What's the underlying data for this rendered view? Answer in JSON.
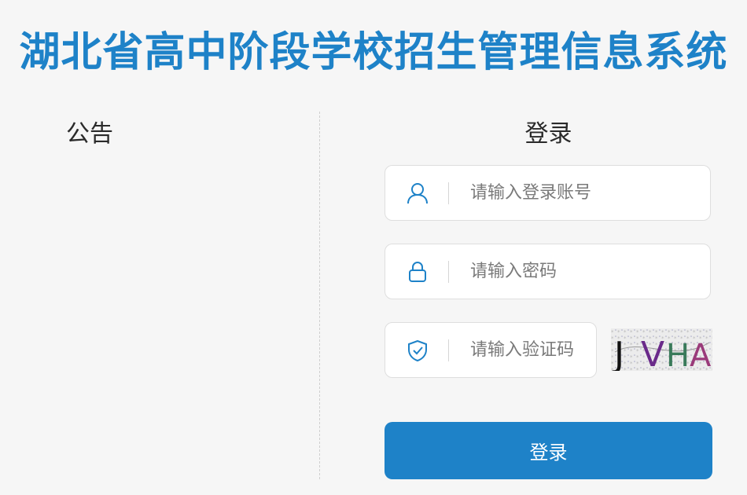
{
  "header": {
    "title": "湖北省高中阶段学校招生管理信息系统"
  },
  "notice": {
    "title": "公告"
  },
  "login": {
    "title": "登录",
    "username": {
      "placeholder": "请输入登录账号",
      "value": "",
      "icon": "user-icon"
    },
    "password": {
      "placeholder": "请输入密码",
      "value": "",
      "icon": "lock-icon"
    },
    "captcha": {
      "placeholder": "请输入验证码",
      "value": "",
      "icon": "shield-check-icon",
      "image_text": "JVHA"
    },
    "submit_label": "登录"
  },
  "colors": {
    "accent": "#1e82c8",
    "background": "#f6f6f6",
    "field_border": "#dedede"
  }
}
